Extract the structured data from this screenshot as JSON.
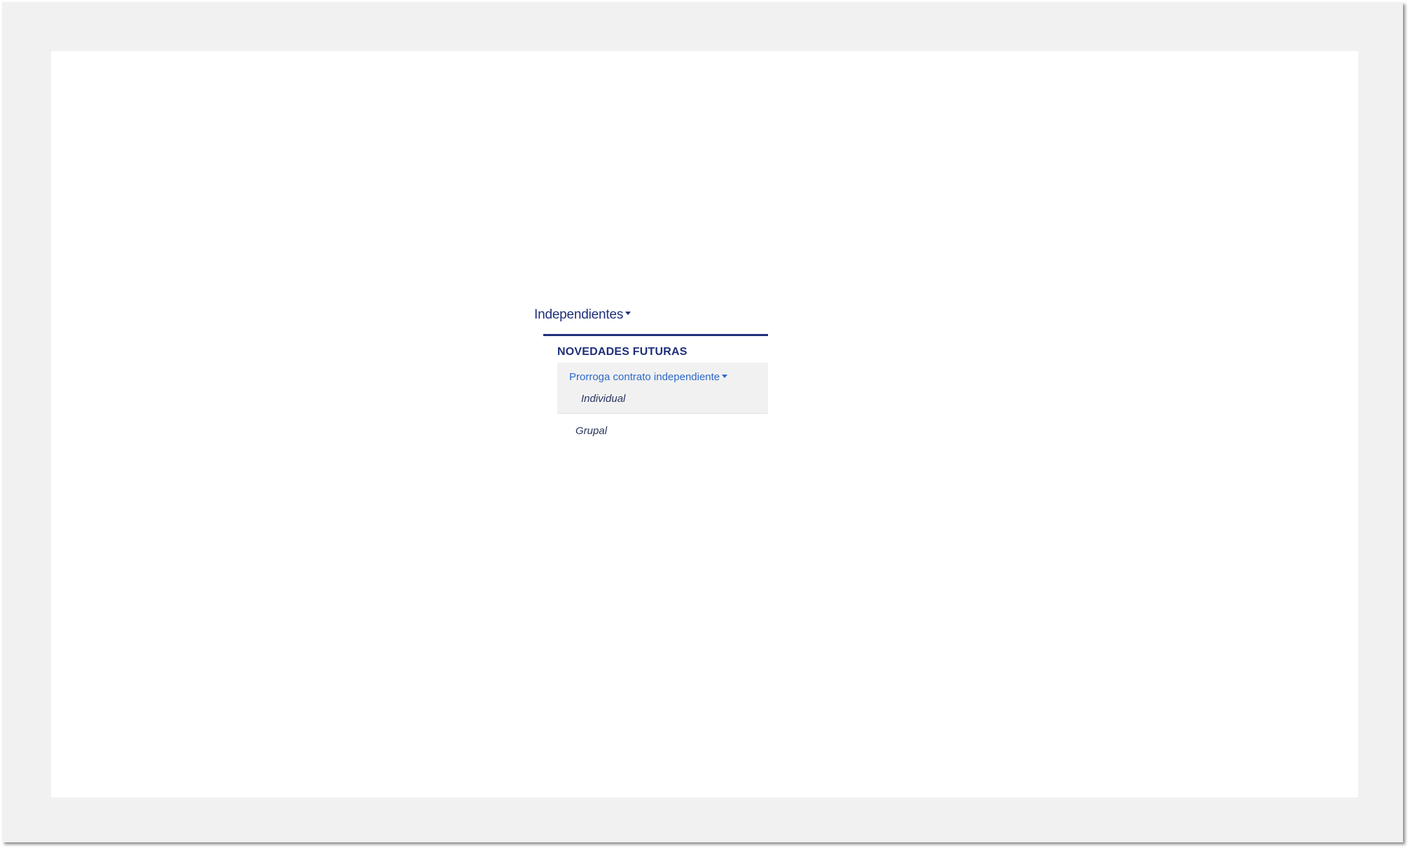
{
  "menu": {
    "trigger_label": "Independientes",
    "colors": {
      "primary": "#1f2f7a",
      "link": "#2e69c9",
      "submenu_bg": "#f1f1f1"
    },
    "section": {
      "heading": "NOVEDADES FUTURAS",
      "submenu": {
        "label": "Prorroga contrato independiente",
        "items": [
          "Individual"
        ]
      },
      "items": [
        "Grupal"
      ]
    }
  }
}
